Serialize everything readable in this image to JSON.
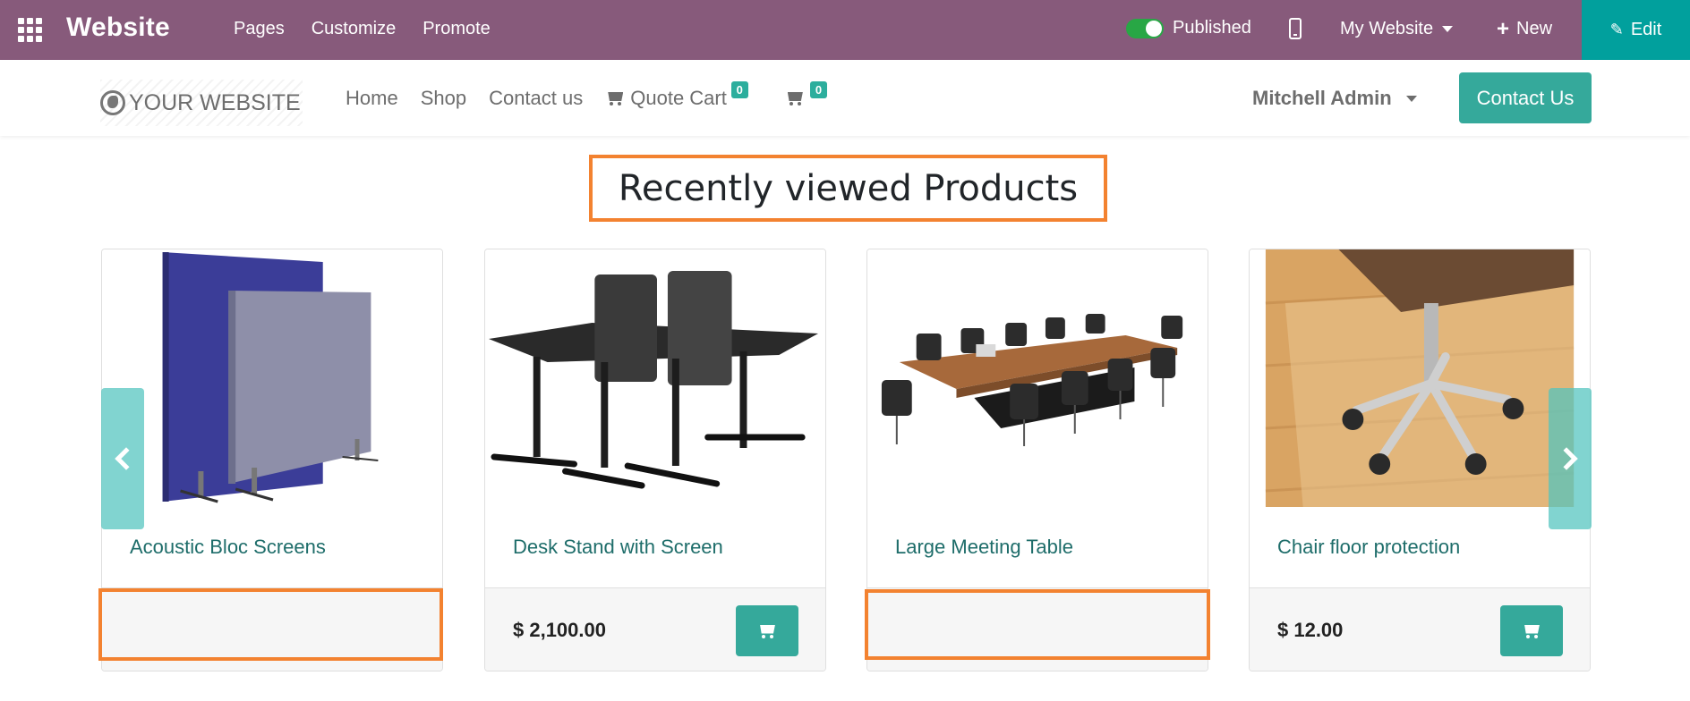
{
  "topbar": {
    "app_name": "Website",
    "menu": [
      "Pages",
      "Customize",
      "Promote"
    ],
    "published_label": "Published",
    "published": true,
    "website_selector": "My Website",
    "new_label": "New",
    "edit_label": "Edit",
    "colors": {
      "bar": "#875a7b",
      "edit": "#01a09d",
      "toggle": "#28a745"
    }
  },
  "header": {
    "logo_text": "YOUR WEBSITE",
    "nav": {
      "home": "Home",
      "shop": "Shop",
      "contact": "Contact us",
      "quote_cart": "Quote Cart",
      "quote_cart_count": "0",
      "cart_count": "0"
    },
    "user_name": "Mitchell Admin",
    "contact_button": "Contact Us",
    "accent": "#35a99b"
  },
  "section": {
    "title": "Recently viewed Products"
  },
  "products": [
    {
      "name": "Acoustic Bloc Screens",
      "price": "",
      "image": "acoustic-screens"
    },
    {
      "name": "Desk Stand with Screen",
      "price": "$ 2,100.00",
      "image": "desk-stand"
    },
    {
      "name": "Large Meeting Table",
      "price": "",
      "image": "meeting-table"
    },
    {
      "name": "Chair floor protection",
      "price": "$ 12.00",
      "image": "chair-floor"
    }
  ],
  "highlight_color": "#f38230"
}
